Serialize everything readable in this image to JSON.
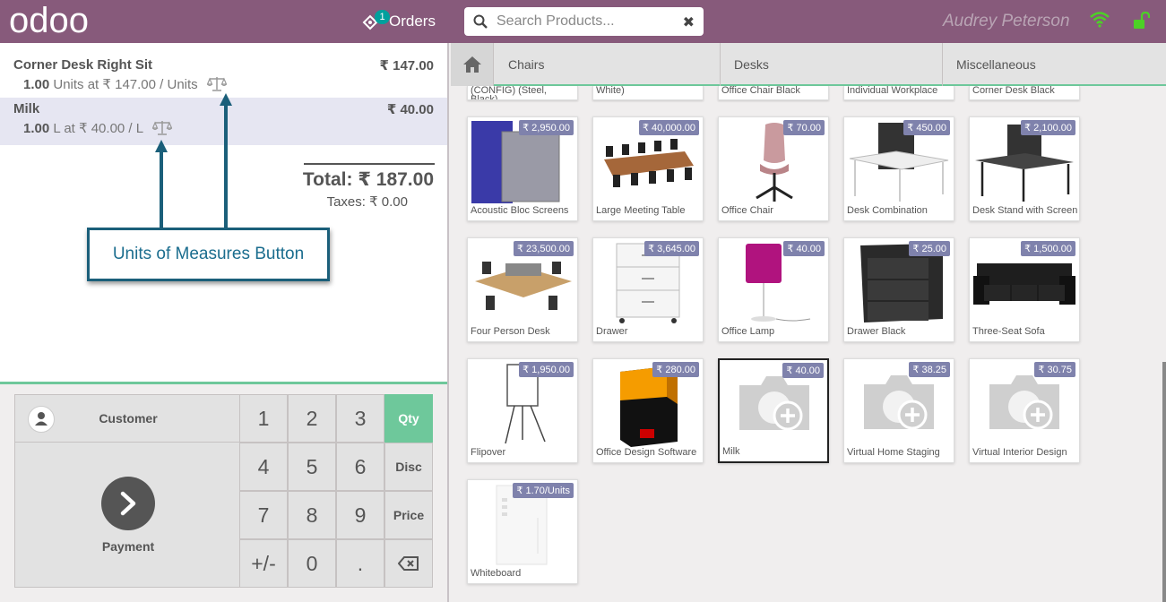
{
  "header": {
    "logo_text": "odoo",
    "orders_label": "Orders",
    "orders_count": "1",
    "search_placeholder": "Search Products...",
    "cashier": "Audrey Peterson",
    "colors": {
      "brand": "#875a7b",
      "accent": "#6ec89b",
      "wifi": "#4cd126"
    }
  },
  "order": {
    "lines": [
      {
        "name": "Corner Desk Right Sit",
        "price": "₹ 147.00",
        "qty": "1.00",
        "unit_text": "Units at ₹ 147.00 / Units"
      },
      {
        "name": "Milk",
        "price": "₹ 40.00",
        "qty": "1.00",
        "unit_text": "L at ₹ 40.00 / L"
      }
    ],
    "total": "Total: ₹ 187.00",
    "taxes": "Taxes: ₹ 0.00"
  },
  "annotation": {
    "text": "Units of Measures Button"
  },
  "numpad": {
    "customer_label": "Customer",
    "payment_label": "Payment",
    "keys": [
      "1",
      "2",
      "3",
      "4",
      "5",
      "6",
      "7",
      "8",
      "9",
      "+/-",
      "0",
      "."
    ],
    "modes": [
      "Qty",
      "Disc",
      "Price"
    ]
  },
  "categories": [
    "Chairs",
    "Desks",
    "Miscellaneous"
  ],
  "partial_products": [
    "(CONFIG) (Steel, Black)",
    "White)",
    "Office Chair Black",
    "Individual Workplace",
    "Corner Desk Black"
  ],
  "products": [
    {
      "name": "Acoustic Bloc Screens",
      "price": "₹ 2,950.00",
      "icon": "acoustic-screen-image"
    },
    {
      "name": "Large Meeting Table",
      "price": "₹ 40,000.00",
      "icon": "meeting-table-image"
    },
    {
      "name": "Office Chair",
      "price": "₹ 70.00",
      "icon": "office-chair-image"
    },
    {
      "name": "Desk Combination",
      "price": "₹ 450.00",
      "icon": "desk-combination-image"
    },
    {
      "name": "Desk Stand with Screen",
      "price": "₹ 2,100.00",
      "icon": "desk-stand-image"
    },
    {
      "name": "Four Person Desk",
      "price": "₹ 23,500.00",
      "icon": "four-person-desk-image"
    },
    {
      "name": "Drawer",
      "price": "₹ 3,645.00",
      "icon": "drawer-image"
    },
    {
      "name": "Office Lamp",
      "price": "₹ 40.00",
      "icon": "lamp-image"
    },
    {
      "name": "Drawer Black",
      "price": "₹ 25.00",
      "icon": "drawer-black-image"
    },
    {
      "name": "Three-Seat Sofa",
      "price": "₹ 1,500.00",
      "icon": "sofa-image"
    },
    {
      "name": "Flipover",
      "price": "₹ 1,950.00",
      "icon": "flipover-image"
    },
    {
      "name": "Office Design Software",
      "price": "₹ 280.00",
      "icon": "software-box-image"
    },
    {
      "name": "Milk",
      "price": "₹ 40.00",
      "icon": "placeholder-camera-icon"
    },
    {
      "name": "Virtual Home Staging",
      "price": "₹ 38.25",
      "icon": "placeholder-camera-icon"
    },
    {
      "name": "Virtual Interior Design",
      "price": "₹ 30.75",
      "icon": "placeholder-camera-icon"
    },
    {
      "name": "Whiteboard",
      "price": "₹ 1.70/Units",
      "icon": "whiteboard-image"
    }
  ]
}
